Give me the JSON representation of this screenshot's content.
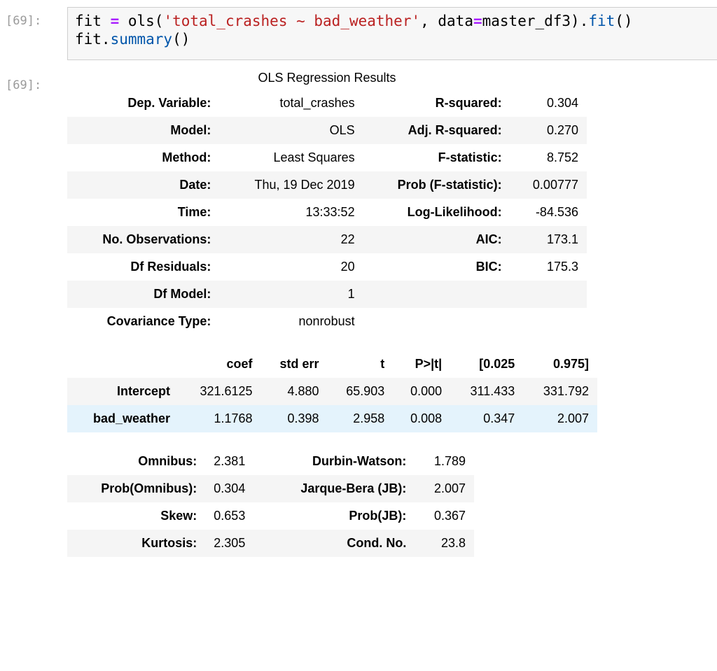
{
  "input_prompt": "[69]:",
  "output_prompt": "[69]:",
  "code": {
    "line1": {
      "p1": "fit ",
      "op": "=",
      "p2": " ols(",
      "str": "'total_crashes ~ bad_weather'",
      "p3": ", data",
      "op2": "=",
      "p4": "master_df3).",
      "fn": "fit",
      "p5": "()"
    },
    "line2": {
      "p1": "fit.",
      "fn": "summary",
      "p2": "()"
    }
  },
  "summary": {
    "caption": "OLS Regression Results",
    "rows": [
      {
        "k1": "Dep. Variable:",
        "v1": "total_crashes",
        "k2": "R-squared:",
        "v2": "0.304"
      },
      {
        "k1": "Model:",
        "v1": "OLS",
        "k2": "Adj. R-squared:",
        "v2": "0.270"
      },
      {
        "k1": "Method:",
        "v1": "Least Squares",
        "k2": "F-statistic:",
        "v2": "8.752"
      },
      {
        "k1": "Date:",
        "v1": "Thu, 19 Dec 2019",
        "k2": "Prob (F-statistic):",
        "v2": "0.00777"
      },
      {
        "k1": "Time:",
        "v1": "13:33:52",
        "k2": "Log-Likelihood:",
        "v2": "-84.536"
      },
      {
        "k1": "No. Observations:",
        "v1": "22",
        "k2": "AIC:",
        "v2": "173.1"
      },
      {
        "k1": "Df Residuals:",
        "v1": "20",
        "k2": "BIC:",
        "v2": "175.3"
      },
      {
        "k1": "Df Model:",
        "v1": "1",
        "k2": "",
        "v2": ""
      },
      {
        "k1": "Covariance Type:",
        "v1": "nonrobust",
        "k2": "",
        "v2": ""
      }
    ]
  },
  "coef_table": {
    "headers": [
      "",
      "coef",
      "std err",
      "t",
      "P>|t|",
      "[0.025",
      "0.975]"
    ],
    "rows": [
      {
        "name": "Intercept",
        "coef": "321.6125",
        "std_err": "4.880",
        "t": "65.903",
        "p": "0.000",
        "lo": "311.433",
        "hi": "331.792"
      },
      {
        "name": "bad_weather",
        "coef": "1.1768",
        "std_err": "0.398",
        "t": "2.958",
        "p": "0.008",
        "lo": "0.347",
        "hi": "2.007"
      }
    ]
  },
  "diag_table": {
    "rows": [
      {
        "k1": "Omnibus:",
        "v1": "2.381",
        "k2": "Durbin-Watson:",
        "v2": "1.789"
      },
      {
        "k1": "Prob(Omnibus):",
        "v1": "0.304",
        "k2": "Jarque-Bera (JB):",
        "v2": "2.007"
      },
      {
        "k1": "Skew:",
        "v1": "0.653",
        "k2": "Prob(JB):",
        "v2": "0.367"
      },
      {
        "k1": "Kurtosis:",
        "v1": "2.305",
        "k2": "Cond. No.",
        "v2": "23.8"
      }
    ]
  }
}
